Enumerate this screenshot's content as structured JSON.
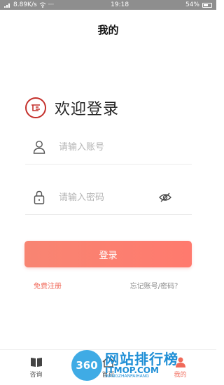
{
  "status_bar": {
    "network_speed": "8.89K/s",
    "dots": "···",
    "time": "19:18",
    "battery": "54%"
  },
  "header": {
    "title": "我的"
  },
  "welcome": {
    "text": "欢迎登录",
    "logo_icon": "brand-logo-icon"
  },
  "form": {
    "account_placeholder": "请输入账号",
    "password_placeholder": "请输入密码",
    "login_label": "登录"
  },
  "links": {
    "register": "免费注册",
    "forgot": "忘记账号/密码？"
  },
  "tabs": [
    {
      "label": "咨询",
      "icon": "book-icon"
    },
    {
      "label": "首页",
      "icon": "home-icon"
    },
    {
      "label": "我的",
      "icon": "user-icon"
    }
  ],
  "watermark": {
    "logo": "360",
    "line1": "网站排行榜",
    "line2": "ITMOP.COM",
    "line3": "WANGZHANPAIHANG"
  },
  "colors": {
    "accent": "#f06a5a",
    "button_start": "#f88572",
    "button_end": "#ff7a6e",
    "logo_red": "#c4302b"
  }
}
